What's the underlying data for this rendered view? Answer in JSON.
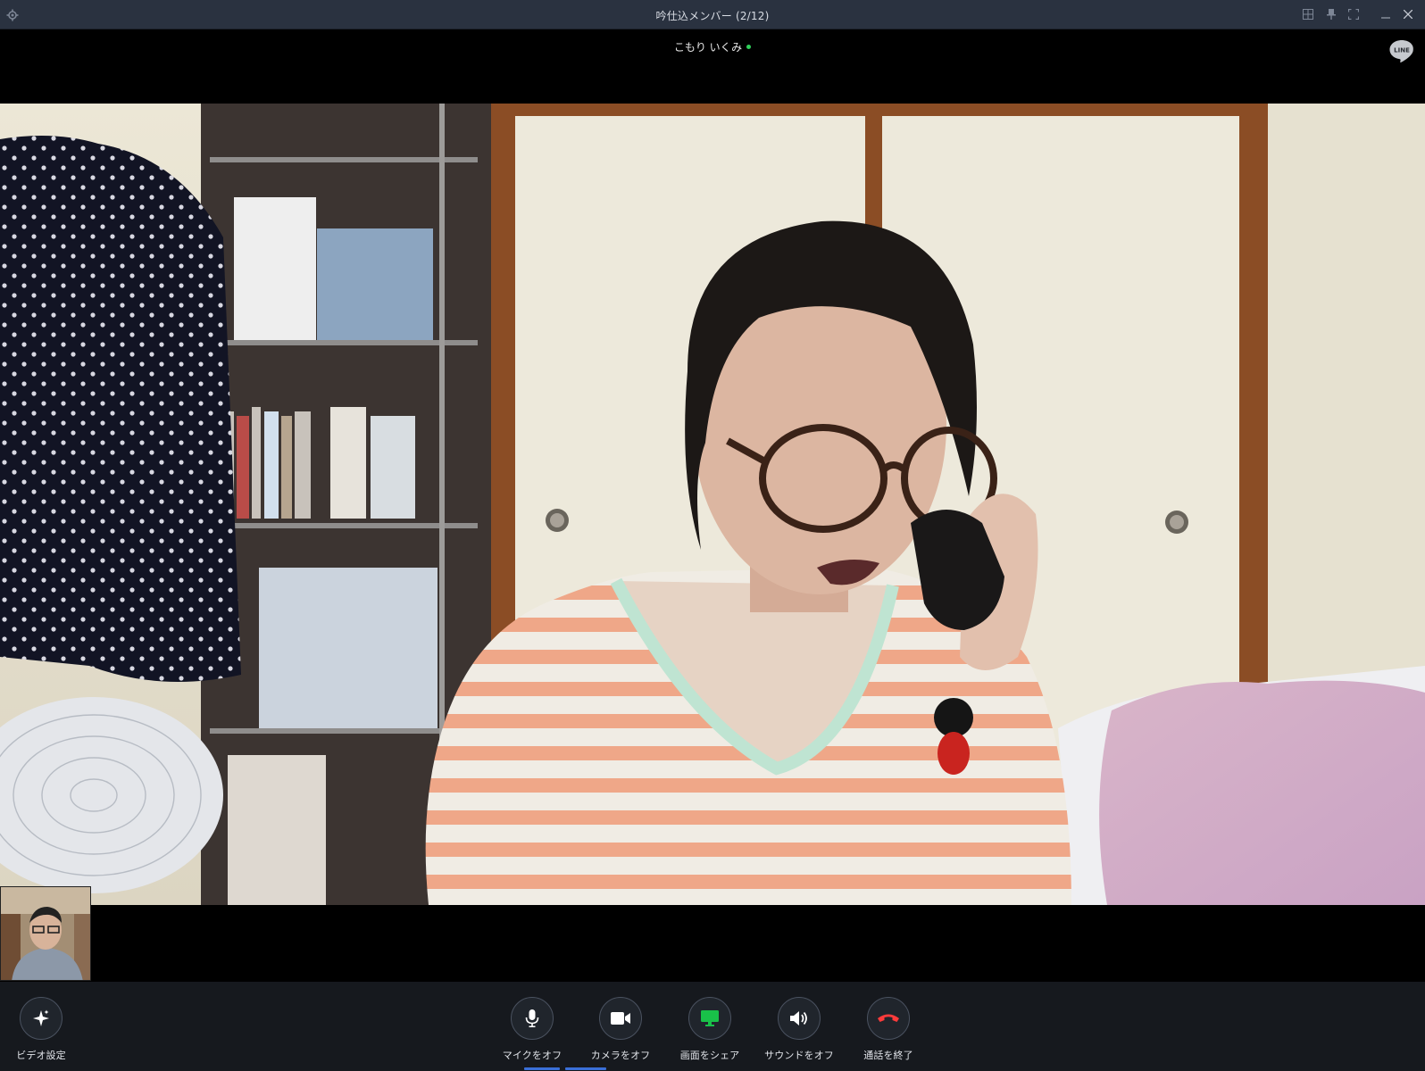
{
  "window": {
    "title": "吟仕込メンバー (2/12)"
  },
  "call": {
    "participant_name": "こもり いくみ",
    "status_color": "#2fd05a"
  },
  "brand": {
    "logo_text": "LINE"
  },
  "controls": {
    "video_settings": {
      "label": "ビデオ設定",
      "icon": "sparkle-icon"
    },
    "mic": {
      "label": "マイクをオフ",
      "icon": "microphone-icon"
    },
    "camera": {
      "label": "カメラをオフ",
      "icon": "video-camera-icon"
    },
    "screen_share": {
      "label": "画面をシェア",
      "icon": "monitor-icon",
      "color": "#19c149"
    },
    "sound": {
      "label": "サウンドをオフ",
      "icon": "speaker-icon"
    },
    "end_call": {
      "label": "通話を終了",
      "icon": "phone-hangup-icon",
      "color": "#ff3b3b"
    }
  },
  "colors": {
    "titlebar": "#2a3240",
    "controlbar": "#16191e"
  }
}
